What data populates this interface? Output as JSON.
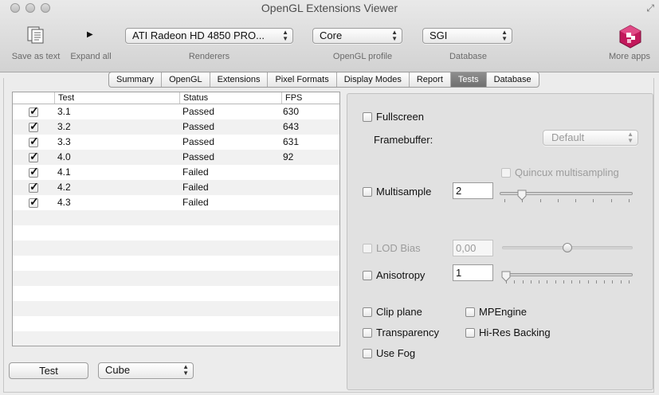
{
  "window": {
    "title": "OpenGL Extensions Viewer"
  },
  "toolbar": {
    "save_label": "Save as text",
    "expand_label": "Expand all",
    "renderers_label": "Renderers",
    "profile_label": "OpenGL profile",
    "database_label": "Database",
    "more_apps_label": "More apps",
    "renderer_value": "ATI Radeon HD 4850 PRO...",
    "profile_value": "Core",
    "database_value": "SGI"
  },
  "tabs": [
    {
      "label": "Summary"
    },
    {
      "label": "OpenGL"
    },
    {
      "label": "Extensions"
    },
    {
      "label": "Pixel Formats"
    },
    {
      "label": "Display Modes"
    },
    {
      "label": "Report"
    },
    {
      "label": "Tests",
      "active": true
    },
    {
      "label": "Database"
    }
  ],
  "table": {
    "headers": [
      "Test",
      "Status",
      "FPS"
    ],
    "rows": [
      {
        "checked": true,
        "test": "3.1",
        "status": "Passed",
        "fps": "630"
      },
      {
        "checked": true,
        "test": "3.2",
        "status": "Passed",
        "fps": "643"
      },
      {
        "checked": true,
        "test": "3.3",
        "status": "Passed",
        "fps": "631"
      },
      {
        "checked": true,
        "test": "4.0",
        "status": "Passed",
        "fps": "92"
      },
      {
        "checked": true,
        "test": "4.1",
        "status": "Failed",
        "fps": ""
      },
      {
        "checked": true,
        "test": "4.2",
        "status": "Failed",
        "fps": ""
      },
      {
        "checked": true,
        "test": "4.3",
        "status": "Failed",
        "fps": ""
      }
    ]
  },
  "bottom": {
    "test_button": "Test",
    "shape_value": "Cube"
  },
  "options": {
    "fullscreen": "Fullscreen",
    "framebuffer_label": "Framebuffer:",
    "framebuffer_value": "Default",
    "quincux": "Quincux multisampling",
    "multisample": "Multisample",
    "multisample_value": "2",
    "lod_bias": "LOD Bias",
    "lod_value": "0,00",
    "anisotropy": "Anisotropy",
    "anisotropy_value": "1",
    "clip_plane": "Clip plane",
    "mpengine": "MPEngine",
    "transparency": "Transparency",
    "hires": "Hi-Res Backing",
    "use_fog": "Use Fog"
  }
}
